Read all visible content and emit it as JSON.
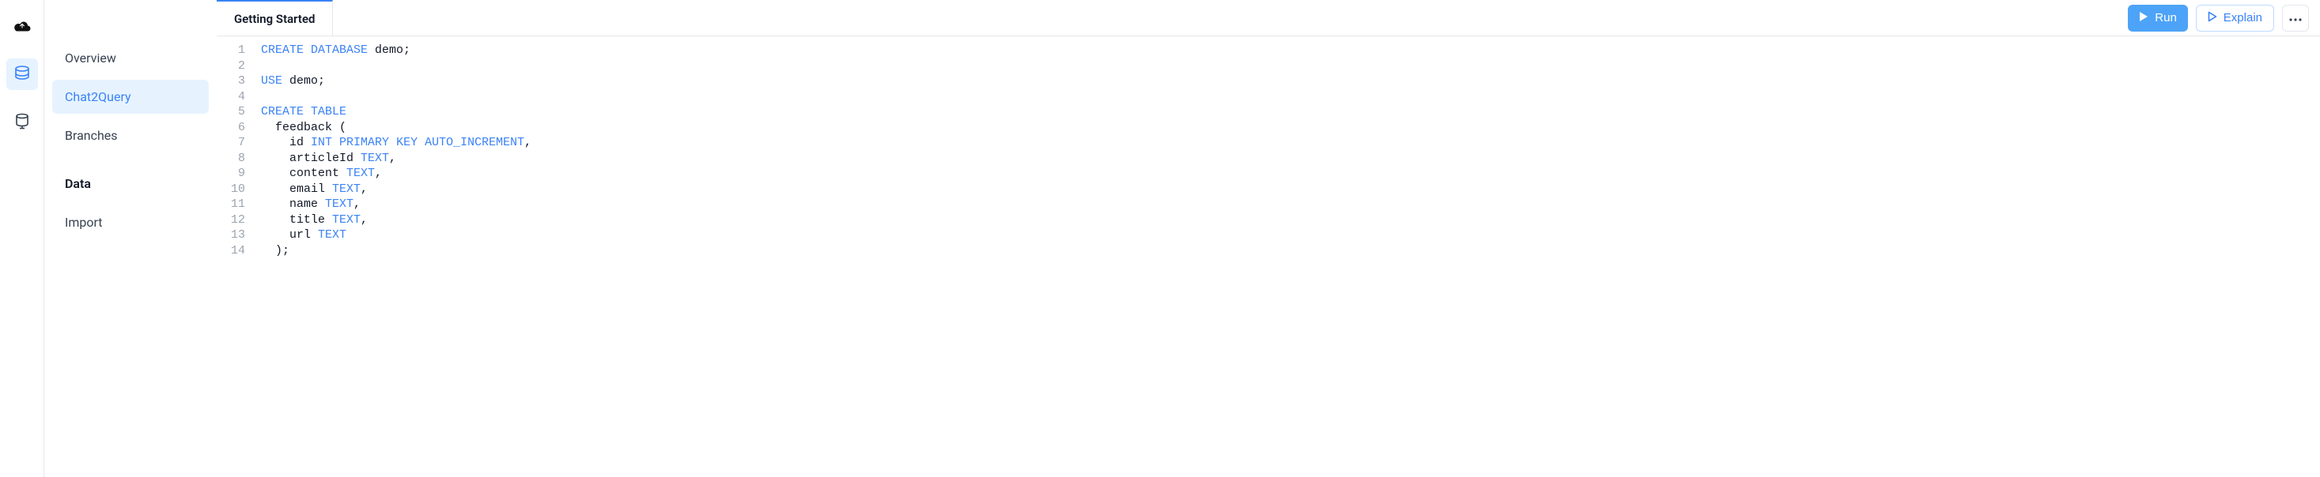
{
  "rail": {
    "icons": [
      "cloud-icon",
      "database-icon",
      "server-icon"
    ]
  },
  "sidebar": {
    "items": [
      {
        "label": "Overview",
        "active": false,
        "bold": false
      },
      {
        "label": "Chat2Query",
        "active": true,
        "bold": false
      },
      {
        "label": "Branches",
        "active": false,
        "bold": false
      },
      {
        "label": "Data",
        "active": false,
        "bold": true
      },
      {
        "label": "Import",
        "active": false,
        "bold": false
      }
    ]
  },
  "tabs": [
    {
      "label": "Getting Started",
      "active": true
    }
  ],
  "actions": {
    "run_label": "Run",
    "explain_label": "Explain"
  },
  "code": {
    "lines": [
      [
        {
          "t": "CREATE",
          "c": "kw"
        },
        {
          "t": " ",
          "c": ""
        },
        {
          "t": "DATABASE",
          "c": "kw"
        },
        {
          "t": " demo;",
          "c": ""
        }
      ],
      [],
      [
        {
          "t": "USE",
          "c": "kw"
        },
        {
          "t": " demo;",
          "c": ""
        }
      ],
      [],
      [
        {
          "t": "CREATE",
          "c": "kw"
        },
        {
          "t": " ",
          "c": ""
        },
        {
          "t": "TABLE",
          "c": "kw"
        }
      ],
      [
        {
          "t": "  feedback (",
          "c": ""
        }
      ],
      [
        {
          "t": "    id ",
          "c": ""
        },
        {
          "t": "INT",
          "c": "ty"
        },
        {
          "t": " ",
          "c": ""
        },
        {
          "t": "PRIMARY",
          "c": "kw"
        },
        {
          "t": " ",
          "c": ""
        },
        {
          "t": "KEY",
          "c": "kw"
        },
        {
          "t": " ",
          "c": ""
        },
        {
          "t": "AUTO_INCREMENT",
          "c": "kw"
        },
        {
          "t": ",",
          "c": ""
        }
      ],
      [
        {
          "t": "    articleId ",
          "c": ""
        },
        {
          "t": "TEXT",
          "c": "ty"
        },
        {
          "t": ",",
          "c": ""
        }
      ],
      [
        {
          "t": "    content ",
          "c": ""
        },
        {
          "t": "TEXT",
          "c": "ty"
        },
        {
          "t": ",",
          "c": ""
        }
      ],
      [
        {
          "t": "    email ",
          "c": ""
        },
        {
          "t": "TEXT",
          "c": "ty"
        },
        {
          "t": ",",
          "c": ""
        }
      ],
      [
        {
          "t": "    name ",
          "c": ""
        },
        {
          "t": "TEXT",
          "c": "ty"
        },
        {
          "t": ",",
          "c": ""
        }
      ],
      [
        {
          "t": "    title ",
          "c": ""
        },
        {
          "t": "TEXT",
          "c": "ty"
        },
        {
          "t": ",",
          "c": ""
        }
      ],
      [
        {
          "t": "    url ",
          "c": ""
        },
        {
          "t": "TEXT",
          "c": "ty"
        }
      ],
      [
        {
          "t": "  );",
          "c": ""
        }
      ]
    ]
  }
}
